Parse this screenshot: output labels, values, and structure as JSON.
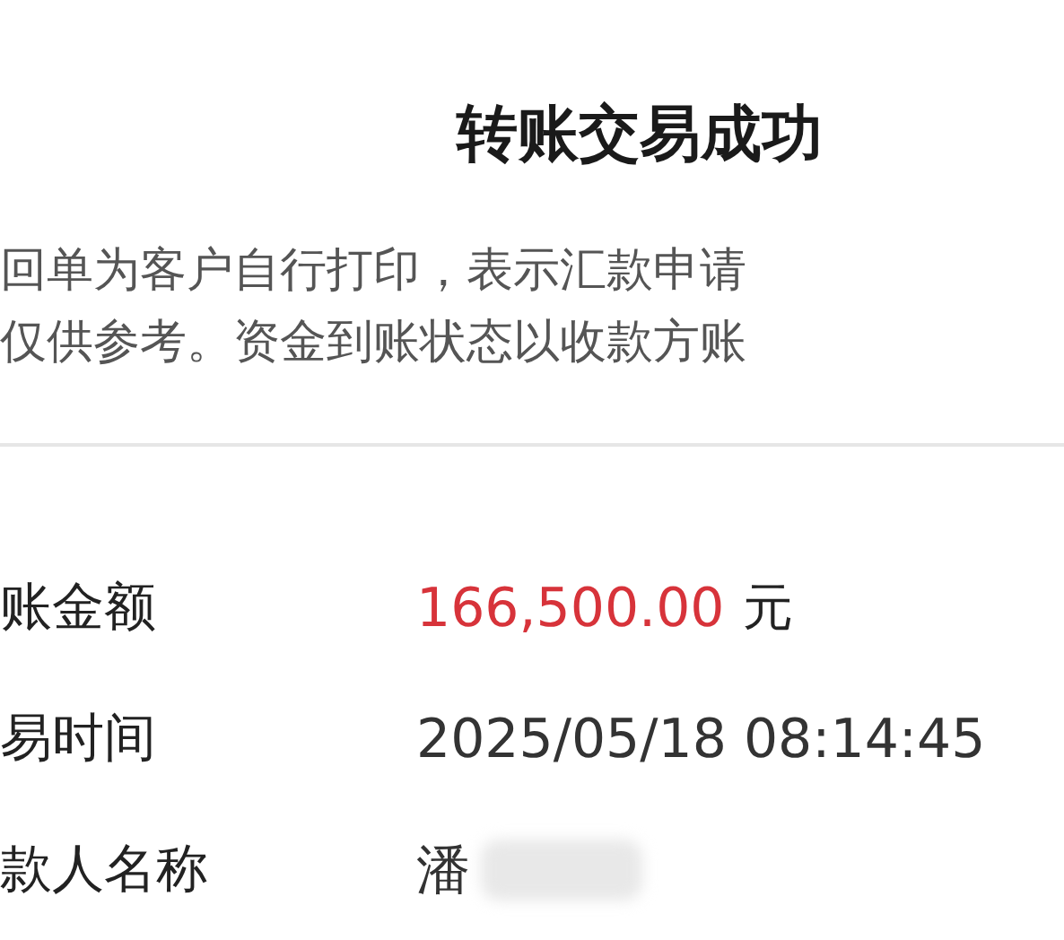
{
  "title": "转账交易成功",
  "notice": [
    "回单为客户自行打印，表示汇款申请",
    "仅供参考。资金到账状态以收款方账"
  ],
  "fields": [
    {
      "label": "账金额",
      "value": "166,500.00",
      "unit": "元",
      "kind": "amount"
    },
    {
      "label": "易时间",
      "value": "2025/05/18 08:14:45",
      "kind": "plain"
    },
    {
      "label": "款人名称",
      "value": "潘",
      "kind": "redacted"
    }
  ]
}
